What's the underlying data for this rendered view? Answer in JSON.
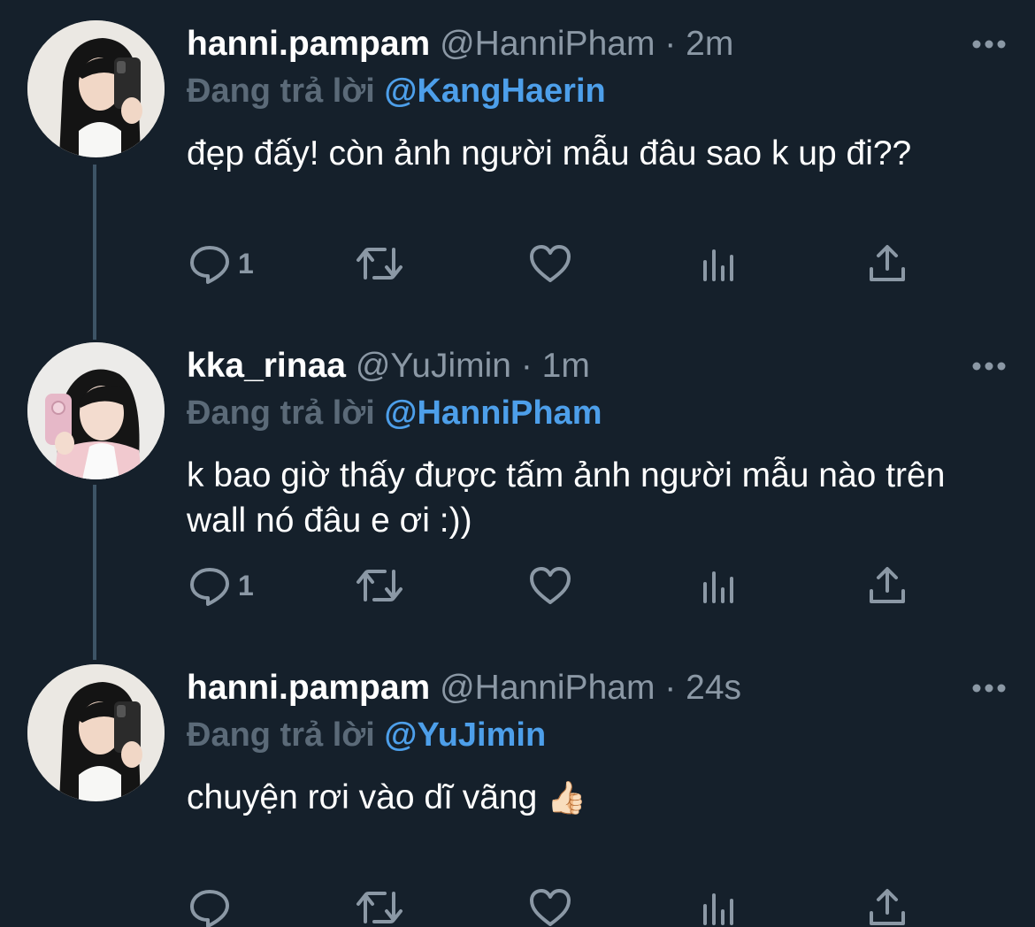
{
  "tweets": [
    {
      "display_name": "hanni.pampam",
      "handle": "@HanniPham",
      "separator": "·",
      "time": "2m",
      "reply_prefix": "Đang trả lời",
      "reply_to": "@KangHaerin",
      "text": "đẹp đấy! còn ảnh người mẫu đâu sao k up đi??",
      "emoji": "",
      "reply_count": "1",
      "avatar": "hanni-avatar"
    },
    {
      "display_name": "kka_rinaa",
      "handle": "@YuJimin",
      "separator": "·",
      "time": "1m",
      "reply_prefix": "Đang trả lời",
      "reply_to": "@HanniPham",
      "text": "k bao giờ thấy được tấm ảnh người mẫu nào trên wall nó đâu e ơi :))",
      "emoji": "",
      "reply_count": "1",
      "avatar": "karina-avatar"
    },
    {
      "display_name": "hanni.pampam",
      "handle": "@HanniPham",
      "separator": "·",
      "time": "24s",
      "reply_prefix": "Đang trả lời",
      "reply_to": "@YuJimin",
      "text": "chuyện rơi vào dĩ vãng",
      "emoji": "👍🏻",
      "reply_count": "",
      "avatar": "hanni-avatar"
    }
  ],
  "icons": {
    "reply": "reply-icon",
    "retweet": "retweet-icon",
    "like": "like-icon",
    "views": "views-icon",
    "share": "share-icon",
    "more": "more-icon"
  },
  "colors": {
    "background": "#15202b",
    "link": "#4d9fea",
    "muted": "#8b98a5",
    "thread_line": "#3d5466"
  }
}
